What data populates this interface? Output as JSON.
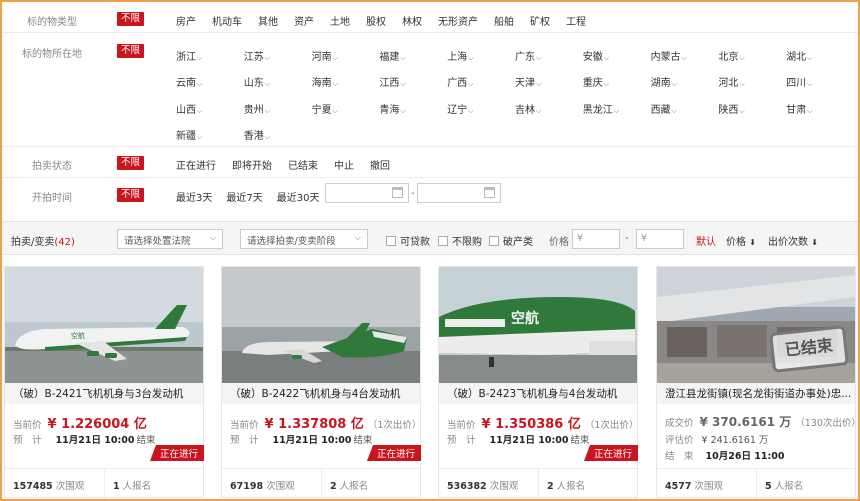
{
  "filters": {
    "type": {
      "label": "标的物类型",
      "badge": "不限",
      "options": [
        "房产",
        "机动车",
        "其他",
        "资产",
        "土地",
        "股权",
        "林权",
        "无形资产",
        "船舶",
        "矿权",
        "工程"
      ]
    },
    "location": {
      "label": "标的物所在地",
      "badge": "不限",
      "rows": [
        [
          "浙江",
          "江苏",
          "河南",
          "福建",
          "上海",
          "广东",
          "安徽",
          "内蒙古",
          "北京",
          "湖北"
        ],
        [
          "云南",
          "山东",
          "海南",
          "江西",
          "广西",
          "天津",
          "重庆",
          "湖南",
          "河北",
          "四川"
        ],
        [
          "山西",
          "贵州",
          "宁夏",
          "青海",
          "辽宁",
          "吉林",
          "黑龙江",
          "西藏",
          "陕西",
          "甘肃"
        ],
        [
          "新疆",
          "香港"
        ]
      ]
    },
    "status": {
      "label": "拍卖状态",
      "badge": "不限",
      "options": [
        "正在进行",
        "即将开始",
        "已结束",
        "中止",
        "撤回"
      ]
    },
    "start_time": {
      "label": "开拍时间",
      "badge": "不限",
      "options": [
        "最近3天",
        "最近7天",
        "最近30天"
      ],
      "range_sep": "-"
    }
  },
  "toolbar": {
    "count_label": "拍卖/变卖",
    "count_open": "(",
    "count": "42",
    "count_close": ")",
    "court_select": "请选择处置法院",
    "stage_select": "请选择拍卖/变卖阶段",
    "checkboxes": [
      "可贷款",
      "不限购",
      "破产类"
    ],
    "price_label": "价格",
    "price_min_placeholder": "¥",
    "price_sep": "-",
    "price_max_placeholder": "¥",
    "sort_default": "默认",
    "sort_price": "价格",
    "sort_bids": "出价次数"
  },
  "cards": [
    {
      "title": "（破）B-2421飞机机身与3台发动机",
      "price_label": "当前价",
      "price": "¥ 1.226004 亿",
      "bids": "",
      "row2_label": "预　计",
      "row2_value": "11月21日 10:00",
      "row2_suffix": "结束",
      "status": "正在进行",
      "views": "157485",
      "views_label": "次围观",
      "applicants": "1",
      "applicants_label": "人报名"
    },
    {
      "title": "（破）B-2422飞机机身与4台发动机",
      "price_label": "当前价",
      "price": "¥ 1.337808 亿",
      "bids": "（1次出价）",
      "row2_label": "预　计",
      "row2_value": "11月21日 10:00",
      "row2_suffix": "结束",
      "status": "正在进行",
      "views": "67198",
      "views_label": "次围观",
      "applicants": "2",
      "applicants_label": "人报名"
    },
    {
      "title": "（破）B-2423飞机机身与4台发动机",
      "price_label": "当前价",
      "price": "¥ 1.350386 亿",
      "bids": "（1次出价）",
      "row2_label": "预　计",
      "row2_value": "11月21日 10:00",
      "row2_suffix": "结束",
      "status": "正在进行",
      "views": "536382",
      "views_label": "次围观",
      "applicants": "2",
      "applicants_label": "人报名"
    },
    {
      "title": "澄江县龙街镇(现名龙街街道办事处)忠...",
      "price_label": "成交价",
      "price": "¥ 370.6161 万",
      "bids": "（130次出价）",
      "row2_label": "评估价",
      "row2_value": "¥ 241.6161 万",
      "row3_label": "结　束",
      "row3_value": "10月26日 11:00",
      "stamp": "已结束",
      "views": "4577",
      "views_label": "次围观",
      "applicants": "5",
      "applicants_label": "人报名"
    }
  ],
  "colors": {
    "accent": "#c9151e",
    "frame": "#f0a04b",
    "plane_green": "#2f7a3b"
  }
}
